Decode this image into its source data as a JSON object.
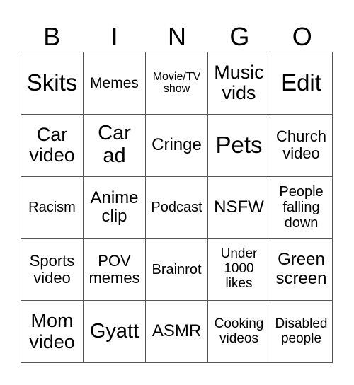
{
  "header": [
    "B",
    "I",
    "N",
    "G",
    "O"
  ],
  "cells": [
    [
      "Skits",
      "Memes",
      "Movie/TV show",
      "Music vids",
      "Edit"
    ],
    [
      "Car video",
      "Car ad",
      "Cringe",
      "Pets",
      "Church video"
    ],
    [
      "Racism",
      "Anime clip",
      "Podcast",
      "NSFW",
      "People falling down"
    ],
    [
      "Sports video",
      "POV memes",
      "Brainrot",
      "Under 1000 likes",
      "Green screen"
    ],
    [
      "Mom video",
      "Gyatt",
      "ASMR",
      "Cooking videos",
      "Disabled people"
    ]
  ]
}
